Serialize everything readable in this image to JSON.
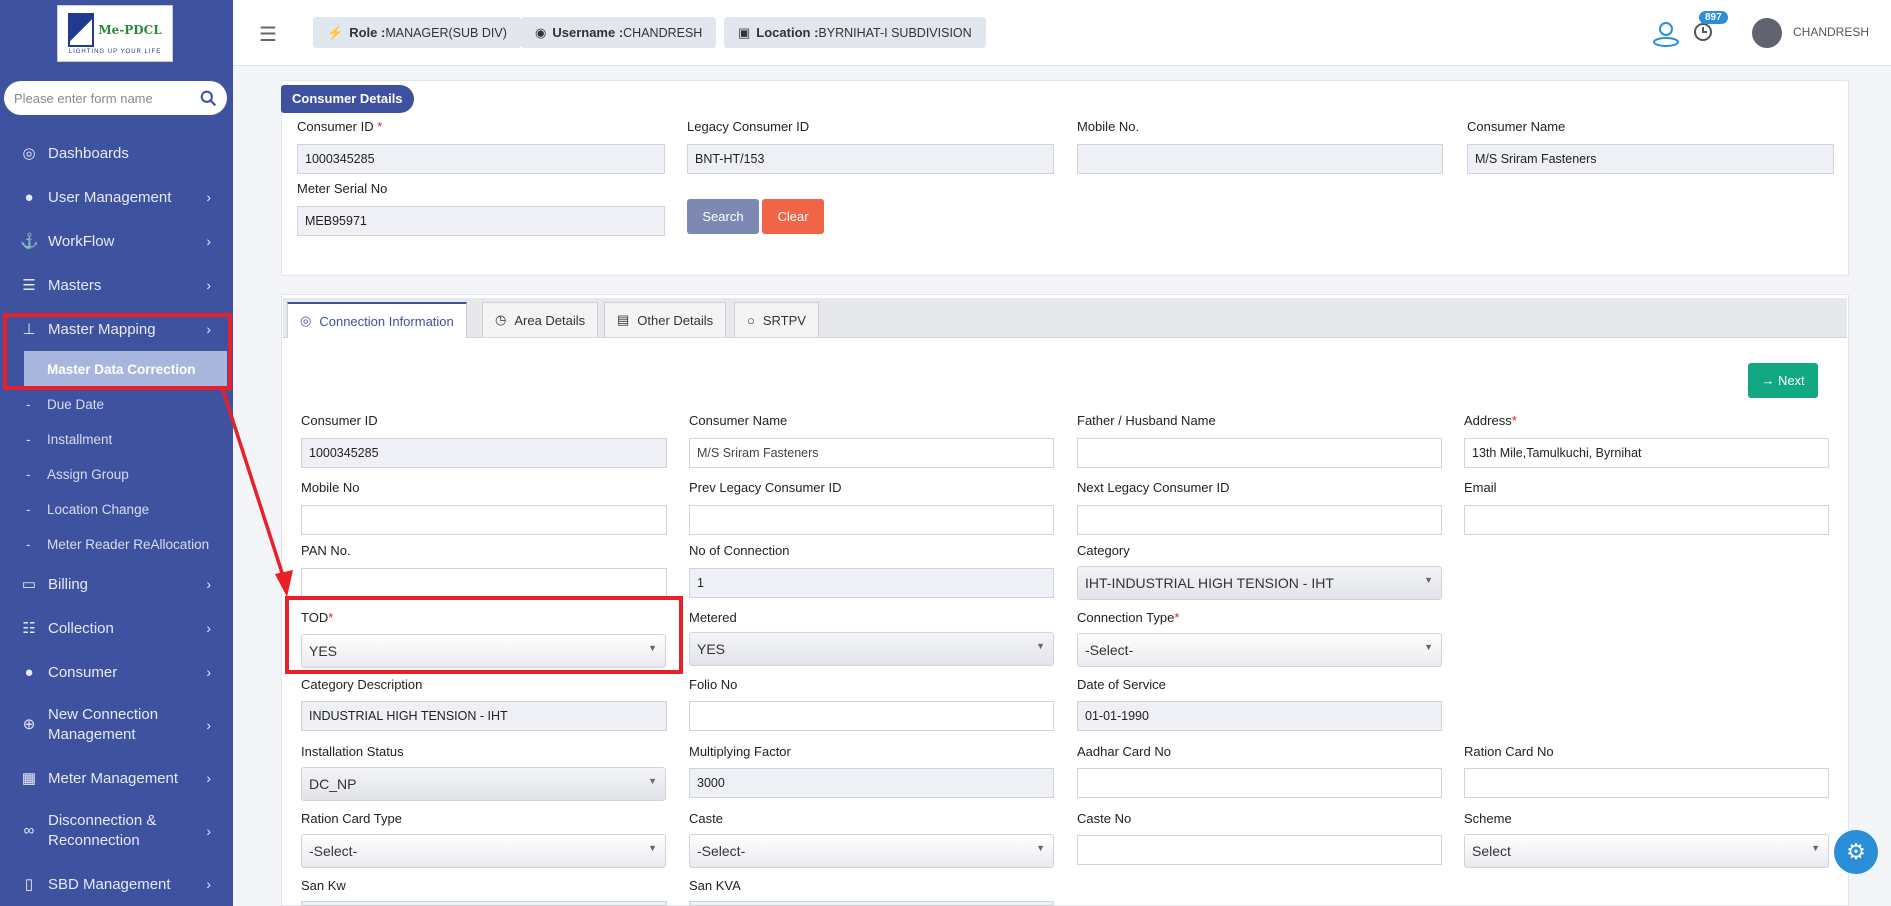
{
  "app": {
    "logo_text": "Me-PDCL",
    "logo_tagline": "LIGHTING UP YOUR LIFE"
  },
  "sidebar": {
    "search_placeholder": "Please enter form name",
    "items": [
      {
        "label": "Dashboards",
        "icon": "dashboard-icon"
      },
      {
        "label": "User Management",
        "icon": "user-icon"
      },
      {
        "label": "WorkFlow",
        "icon": "anchor-icon"
      },
      {
        "label": "Masters",
        "icon": "list-icon"
      },
      {
        "label": "Master Mapping",
        "icon": "sitemap-icon"
      },
      {
        "label": "Billing",
        "icon": "monitor-icon"
      },
      {
        "label": "Collection",
        "icon": "checklist-icon"
      },
      {
        "label": "Consumer",
        "icon": "user-icon"
      },
      {
        "label": "New Connection Management",
        "icon": "plus-circle-icon"
      },
      {
        "label": "Meter Management",
        "icon": "grid-icon"
      },
      {
        "label": "Disconnection & Reconnection",
        "icon": "link-icon"
      },
      {
        "label": "SBD Management",
        "icon": "device-icon"
      }
    ],
    "sub_items": [
      {
        "label": "Master Data Correction"
      },
      {
        "label": "Due Date"
      },
      {
        "label": "Installment"
      },
      {
        "label": "Assign Group"
      },
      {
        "label": "Location Change"
      },
      {
        "label": "Meter Reader ReAllocation"
      }
    ]
  },
  "topbar": {
    "role_label": "Role :",
    "role_value": "MANAGER(SUB DIV)",
    "username_label": "Username :",
    "username_value": "CHANDRESH",
    "location_label": "Location :",
    "location_value": "BYRNIHAT-I SUBDIVISION",
    "notification_count": "897",
    "user_name": "CHANDRESH"
  },
  "consumer_details": {
    "title": "Consumer Details",
    "consumer_id_label": "Consumer ID",
    "consumer_id": "1000345285",
    "legacy_id_label": "Legacy Consumer ID",
    "legacy_id": "BNT-HT/153",
    "mobile_label": "Mobile No.",
    "mobile": "",
    "name_label": "Consumer Name",
    "name": "M/S Sriram Fasteners",
    "meter_serial_label": "Meter Serial No",
    "meter_serial": "MEB95971",
    "search_label": "Search",
    "clear_label": "Clear"
  },
  "tabs": [
    {
      "label": "Connection Information",
      "icon": "target-icon"
    },
    {
      "label": "Area Details",
      "icon": "clock-icon"
    },
    {
      "label": "Other Details",
      "icon": "chart-icon"
    },
    {
      "label": "SRTPV",
      "icon": "circle-icon"
    }
  ],
  "next_label": "→ Next",
  "form": {
    "consumer_id_label": "Consumer ID",
    "consumer_id": "1000345285",
    "consumer_name_label": "Consumer Name",
    "consumer_name": "M/S Sriram Fasteners",
    "father_label": "Father / Husband Name",
    "father": "",
    "address_label": "Address",
    "address": "13th Mile,Tamulkuchi, Byrnihat",
    "mobile_label": "Mobile No",
    "mobile": "",
    "prev_legacy_label": "Prev Legacy Consumer ID",
    "prev_legacy": "",
    "next_legacy_label": "Next Legacy Consumer ID",
    "next_legacy": "",
    "email_label": "Email",
    "email": "",
    "pan_label": "PAN No.",
    "pan": "",
    "no_conn_label": "No of Connection",
    "no_conn": "1",
    "category_label": "Category",
    "category": "IHT-INDUSTRIAL HIGH TENSION - IHT",
    "tod_label": "TOD",
    "tod": "YES",
    "metered_label": "Metered",
    "metered": "YES",
    "conn_type_label": "Connection Type",
    "conn_type": "-Select-",
    "cat_desc_label": "Category Description",
    "cat_desc": "INDUSTRIAL HIGH TENSION - IHT",
    "folio_label": "Folio No",
    "folio": "",
    "date_service_label": "Date of Service",
    "date_service": "01-01-1990",
    "install_status_label": "Installation Status",
    "install_status": "DC_NP",
    "mult_factor_label": "Multiplying Factor",
    "mult_factor": "3000",
    "aadhar_label": "Aadhar Card No",
    "aadhar": "",
    "ration_label": "Ration Card No",
    "ration": "",
    "ration_type_label": "Ration Card Type",
    "ration_type": "-Select-",
    "caste_label": "Caste",
    "caste": "-Select-",
    "caste_no_label": "Caste No",
    "caste_no": "",
    "scheme_label": "Scheme",
    "scheme": "Select",
    "san_kw_label": "San Kw",
    "san_kva_label": "San KVA"
  }
}
